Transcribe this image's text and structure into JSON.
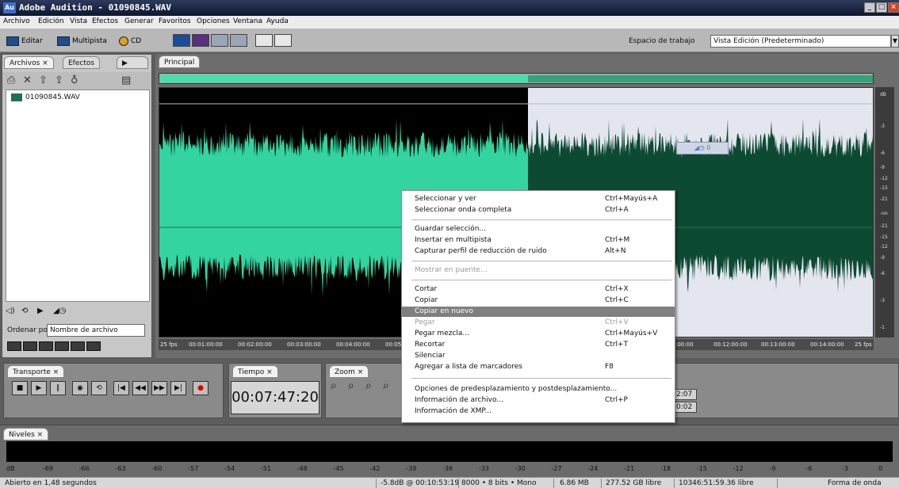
{
  "titlebar": {
    "logo": "Au",
    "title": "Adobe Audition - 01090845.WAV"
  },
  "menus": [
    "Archivo",
    "Edición",
    "Vista",
    "Efectos",
    "Generar",
    "Favoritos",
    "Opciones",
    "Ventana",
    "Ayuda"
  ],
  "toolbar": {
    "editar_label": "Editar",
    "multipista_label": "Multipista",
    "cd_label": "CD",
    "workspace_label": "Espacio de trabajo",
    "workspace_value": "Vista Edición (Predeterminado)"
  },
  "leftpanel": {
    "tab_files": "Archivos ×",
    "tab_effects": "Efectos",
    "file_name": "01090845.WAV",
    "sort_label": "Ordenar por:",
    "sort_value": "Nombre de archivo"
  },
  "main": {
    "tab": "Principal",
    "readout_value": "0",
    "db_label": "dB",
    "db_ticks": [
      "-3",
      "-6",
      "-9",
      "-12",
      "-15",
      "-21",
      "-oo",
      "-21",
      "-15",
      "-12",
      "-9",
      "-6",
      "-3",
      "-1"
    ],
    "timeline": [
      "25 fps",
      "00:01:00:00",
      "00:02:00:00",
      "00:03:00:00",
      "00:04:00:00",
      "00:05:0",
      ":00:00",
      "00:12:00:00",
      "00:13:00:00",
      "00:14:00:00",
      "25 fps"
    ]
  },
  "transport": {
    "tab": "Transporte ×"
  },
  "time": {
    "tab": "Tiempo ×",
    "value": "00:07:47:20"
  },
  "zoom": {
    "tab": "Zoom ×"
  },
  "selection": {
    "v1": "2:07",
    "v2": "0:02"
  },
  "levels": {
    "tab": "Niveles ×",
    "scale": [
      "dB",
      "-69",
      "-66",
      "-63",
      "-60",
      "-57",
      "-54",
      "-51",
      "-48",
      "-45",
      "-42",
      "-39",
      "-36",
      "-33",
      "-30",
      "-27",
      "-24",
      "-21",
      "-18",
      "-15",
      "-12",
      "-9",
      "-6",
      "-3",
      "0"
    ]
  },
  "status": {
    "open_time": "Abierto en 1,48 segundos",
    "cursor": "-5.8dB @ 00:10:53:19",
    "format": "8000 • 8 bits • Mono",
    "size": "6.86 MB",
    "free1": "277.52 GB libre",
    "free2": "10346:51:59.36 libre",
    "view": "Forma de onda"
  },
  "context_menu": {
    "items": [
      {
        "label": "Seleccionar y ver",
        "shortcut": "Ctrl+Mayús+A"
      },
      {
        "label": "Seleccionar onda completa",
        "shortcut": "Ctrl+A"
      },
      {
        "label": "Guardar selección...",
        "shortcut": ""
      },
      {
        "label": "Insertar en multipista",
        "shortcut": "Ctrl+M"
      },
      {
        "label": "Capturar perfil de reducción de ruido",
        "shortcut": "Alt+N"
      },
      {
        "label": "Mostrar en puente...",
        "shortcut": ""
      },
      {
        "label": "Cortar",
        "shortcut": "Ctrl+X"
      },
      {
        "label": "Copiar",
        "shortcut": "Ctrl+C"
      },
      {
        "label": "Copiar en nuevo",
        "shortcut": ""
      },
      {
        "label": "Pegar",
        "shortcut": "Ctrl+V"
      },
      {
        "label": "Pegar mezcla...",
        "shortcut": "Ctrl+Mayús+V"
      },
      {
        "label": "Recortar",
        "shortcut": "Ctrl+T"
      },
      {
        "label": "Silenciar",
        "shortcut": ""
      },
      {
        "label": "Agregar a lista de marcadores",
        "shortcut": "F8"
      },
      {
        "label": "Opciones de predesplazamiento y postdesplazamiento...",
        "shortcut": ""
      },
      {
        "label": "Información de archivo...",
        "shortcut": "Ctrl+P"
      },
      {
        "label": "Información de XMP...",
        "shortcut": ""
      }
    ]
  },
  "colors": {
    "wave_selected": "#33d49f",
    "wave_unselected": "#0d4a33",
    "bg_selected": "#000000",
    "bg_unselected": "#e4e6ef"
  }
}
